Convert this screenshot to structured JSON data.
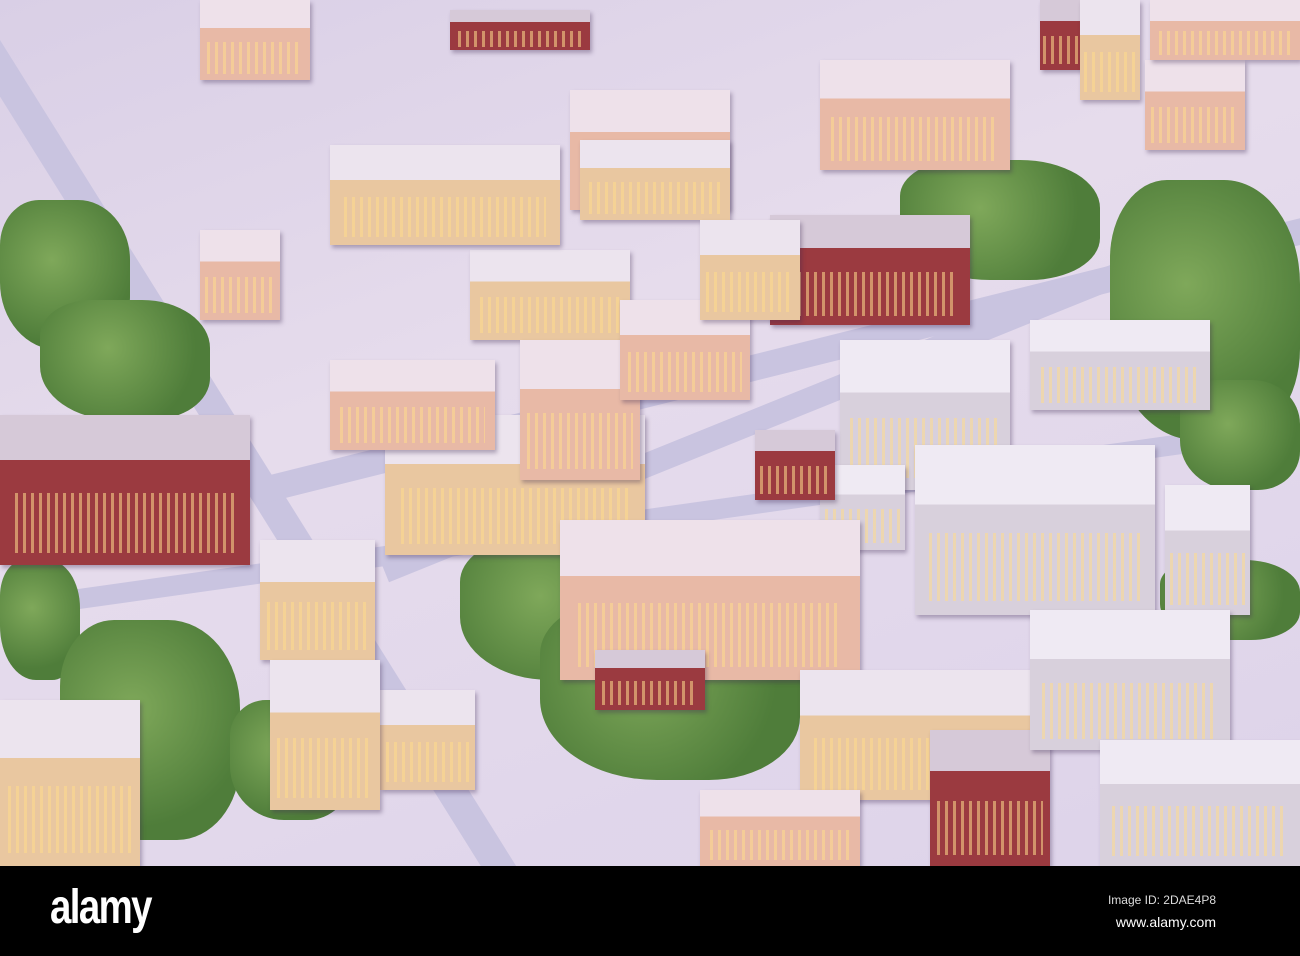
{
  "photo": {
    "subject": "city-model"
  },
  "watermark": {
    "logo": "alamy",
    "image_id": "Image ID: 2DAE4P8",
    "url": "www.alamy.com"
  }
}
